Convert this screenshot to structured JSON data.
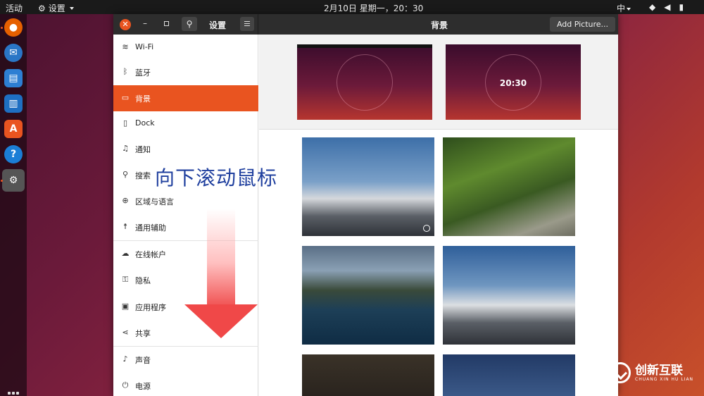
{
  "topbar": {
    "activities": "活动",
    "app_menu": "设置",
    "clock": "2月10日 星期一，20：30",
    "ime": "中"
  },
  "window": {
    "sidebar_title": "设置",
    "page_title": "背景",
    "add_picture": "Add Picture...",
    "lock_preview_time": "20:30"
  },
  "sidebar": {
    "items": [
      {
        "label": "Wi-Fi",
        "icon": "wifi-icon"
      },
      {
        "label": "蓝牙",
        "icon": "bluetooth-icon"
      },
      {
        "label": "背景",
        "icon": "background-icon"
      },
      {
        "label": "Dock",
        "icon": "dock-icon"
      },
      {
        "label": "通知",
        "icon": "bell-icon"
      },
      {
        "label": "搜索",
        "icon": "search-icon"
      },
      {
        "label": "区域与语言",
        "icon": "globe-icon"
      },
      {
        "label": "通用辅助",
        "icon": "accessibility-icon"
      },
      {
        "label": "在线帐户",
        "icon": "cloud-icon"
      },
      {
        "label": "隐私",
        "icon": "lock-icon"
      },
      {
        "label": "应用程序",
        "icon": "apps-icon"
      },
      {
        "label": "共享",
        "icon": "share-icon"
      },
      {
        "label": "声音",
        "icon": "music-note-icon"
      },
      {
        "label": "电源",
        "icon": "power-icon"
      }
    ],
    "active_index": 2
  },
  "annotation": {
    "text": "向下滚动鼠标",
    "arrow_color": "#f04848"
  },
  "watermark": {
    "text": "创新互联",
    "sub": "CHUANG XIN HU LIAN"
  },
  "colors": {
    "accent": "#e95420",
    "headerbar": "#2d2d2d",
    "annotation_text": "#1f3f9e"
  }
}
